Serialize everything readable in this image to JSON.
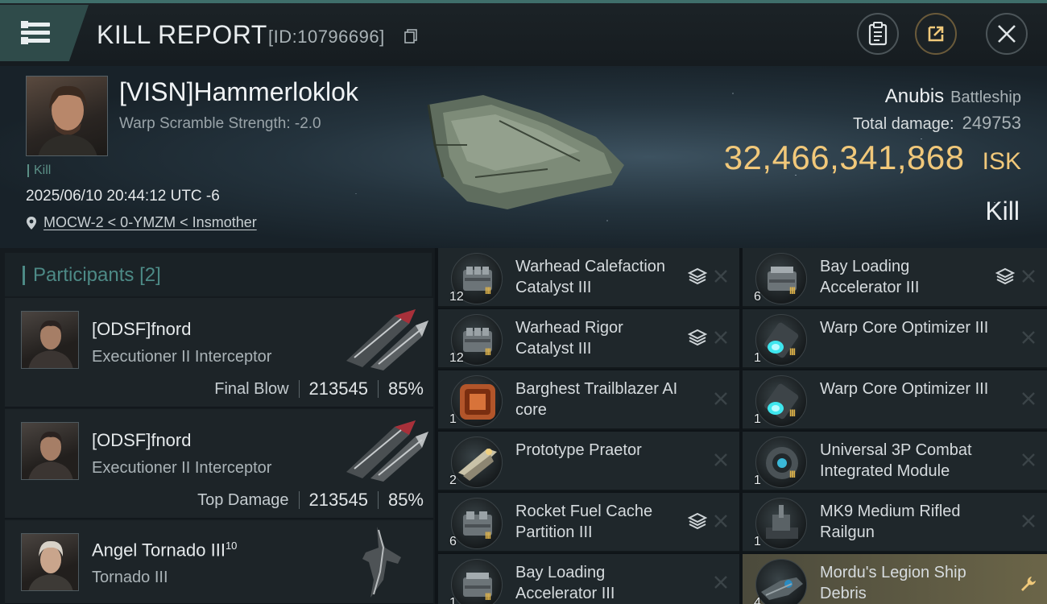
{
  "header": {
    "title": "KILL REPORT",
    "report_id": "[ID:10796696]"
  },
  "victim": {
    "name": "[VISN]Hammerloklok",
    "warp_scramble": "Warp Scramble Strength: -2.0",
    "tag": "Kill",
    "datetime": "2025/06/10 20:44:12 UTC -6",
    "location": "MOCW-2 < 0-YMZM < Insmother",
    "ship_name": "Anubis",
    "ship_class": "Battleship",
    "total_damage_label": "Total damage:",
    "total_damage": "249753",
    "isk_value": "32,466,341,868",
    "isk_unit": "ISK",
    "result": "Kill"
  },
  "participants": {
    "label": "Participants",
    "count": "[2]",
    "list": [
      {
        "name": "[ODSF]fnord",
        "ship": "Executioner II Interceptor",
        "role": "Final Blow",
        "damage": "213545",
        "percent": "85%"
      },
      {
        "name": "[ODSF]fnord",
        "ship": "Executioner II Interceptor",
        "role": "Top Damage",
        "damage": "213545",
        "percent": "85%"
      },
      {
        "name": "Angel Tornado III",
        "name_sup": "10",
        "ship": "Tornado III"
      }
    ]
  },
  "items": [
    {
      "name": "Warhead Calefaction Catalyst III",
      "qty": "12",
      "stack": true,
      "icon": "warhead-module-icon"
    },
    {
      "name": "Bay Loading Accelerator III",
      "qty": "6",
      "stack": true,
      "icon": "bay-loading-module-icon"
    },
    {
      "name": "Warhead Rigor Catalyst III",
      "qty": "12",
      "stack": true,
      "icon": "warhead-module-icon"
    },
    {
      "name": "Warp Core Optimizer III",
      "qty": "1",
      "stack": false,
      "icon": "warp-core-icon"
    },
    {
      "name": "Barghest Trailblazer AI core",
      "qty": "1",
      "stack": false,
      "icon": "ai-core-icon"
    },
    {
      "name": "Warp Core Optimizer III",
      "qty": "1",
      "stack": false,
      "icon": "warp-core-icon"
    },
    {
      "name": "Prototype  Praetor",
      "qty": "2",
      "stack": false,
      "icon": "drone-icon"
    },
    {
      "name": "Universal 3P Combat Integrated Module",
      "qty": "1",
      "stack": false,
      "icon": "combat-module-icon"
    },
    {
      "name": "Rocket Fuel Cache Partition III",
      "qty": "6",
      "stack": true,
      "icon": "fuel-module-icon"
    },
    {
      "name": "MK9 Medium Rifled Railgun",
      "qty": "1",
      "stack": false,
      "icon": "railgun-icon"
    },
    {
      "name": "Bay Loading Accelerator III",
      "qty": "1",
      "stack": false,
      "icon": "bay-loading-module-icon"
    },
    {
      "name": "Mordu's Legion Ship Debris",
      "qty": "4",
      "stack": false,
      "icon": "ship-debris-icon",
      "highlight": true
    }
  ],
  "colors": {
    "accent": "#4d8a86",
    "isk": "#f1c87a",
    "highlight": "#6b6548"
  }
}
